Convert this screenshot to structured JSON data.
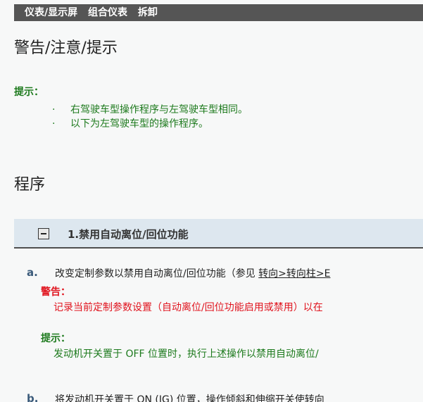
{
  "breadcrumb": {
    "items": [
      "仪表/显示屏",
      "组合仪表",
      "拆卸"
    ]
  },
  "headings": {
    "warning": "警告/注意/提示",
    "procedure": "程序"
  },
  "hint": {
    "label": "提示：",
    "items": [
      "右驾驶车型操作程序与左驾驶车型相同。",
      "以下为左驾驶车型的操作程序。"
    ]
  },
  "section": {
    "title": "1.禁用自动离位/回位功能"
  },
  "steps": {
    "a": {
      "letter": "a.",
      "text": "改变定制参数以禁用自动离位/回位功能（参见 ",
      "link": "转向>转向柱>E",
      "warning_label": "警告：",
      "warning_text": "记录当前定制参数设置（自动离位/回位功能启用或禁用）以在",
      "note_label": "提示：",
      "note_text": "发动机开关置于 OFF 位置时，执行上述操作以禁用自动离位/"
    },
    "b": {
      "letter": "b.",
      "text": "将发动机开关置于 ON (IG) 位置，操作倾斜和伸缩开关使转向"
    }
  },
  "colors": {
    "breadcrumb_bg": "#555555",
    "hint_green": "#1d7a1d",
    "warning_red": "#e0141e",
    "section_bg": "#dde7ef"
  }
}
